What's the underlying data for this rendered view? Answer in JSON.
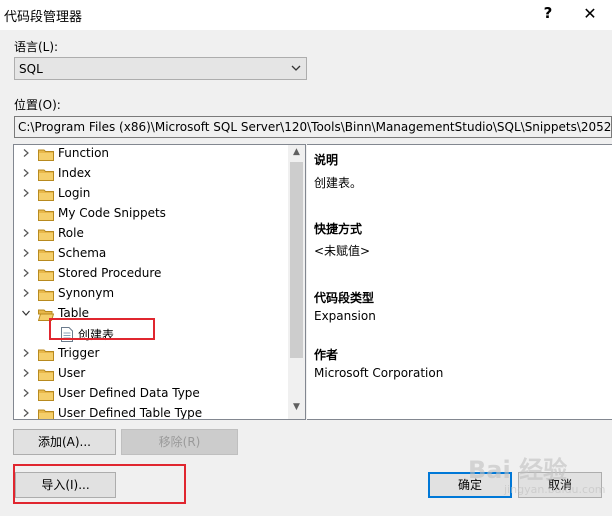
{
  "window": {
    "title": "代码段管理器",
    "help": "?",
    "close": "✕"
  },
  "language": {
    "label": "语言(L):",
    "selected": "SQL"
  },
  "location": {
    "label": "位置(O):",
    "path": "C:\\Program Files (x86)\\Microsoft SQL Server\\120\\Tools\\Binn\\ManagementStudio\\SQL\\Snippets\\2052"
  },
  "tree": {
    "items": [
      {
        "label": "Function",
        "expandable": true
      },
      {
        "label": "Index",
        "expandable": true
      },
      {
        "label": "Login",
        "expandable": true
      },
      {
        "label": "My Code Snippets",
        "expandable": false
      },
      {
        "label": "Role",
        "expandable": true
      },
      {
        "label": "Schema",
        "expandable": true
      },
      {
        "label": "Stored Procedure",
        "expandable": true
      },
      {
        "label": "Synonym",
        "expandable": true
      },
      {
        "label": "Table",
        "expandable": true,
        "expanded": true
      },
      {
        "label": "Trigger",
        "expandable": true
      },
      {
        "label": "User",
        "expandable": true
      },
      {
        "label": "User Defined Data Type",
        "expandable": true
      },
      {
        "label": "User Defined Table Type",
        "expandable": true
      }
    ],
    "child": {
      "label": "创建表"
    }
  },
  "details": {
    "description_heading": "说明",
    "description": "创建表。",
    "shortcut_heading": "快捷方式",
    "shortcut": "<未赋值>",
    "type_heading": "代码段类型",
    "type": "Expansion",
    "author_heading": "作者",
    "author": "Microsoft Corporation"
  },
  "buttons": {
    "add": "添加(A)...",
    "remove": "移除(R)",
    "import": "导入(I)...",
    "ok": "确定",
    "cancel": "取消"
  },
  "watermark": {
    "text": "Bai 经验",
    "sub": "jingyan.baidu.com"
  },
  "colors": {
    "highlight": "#e0262f",
    "default_button": "#0078d7"
  }
}
